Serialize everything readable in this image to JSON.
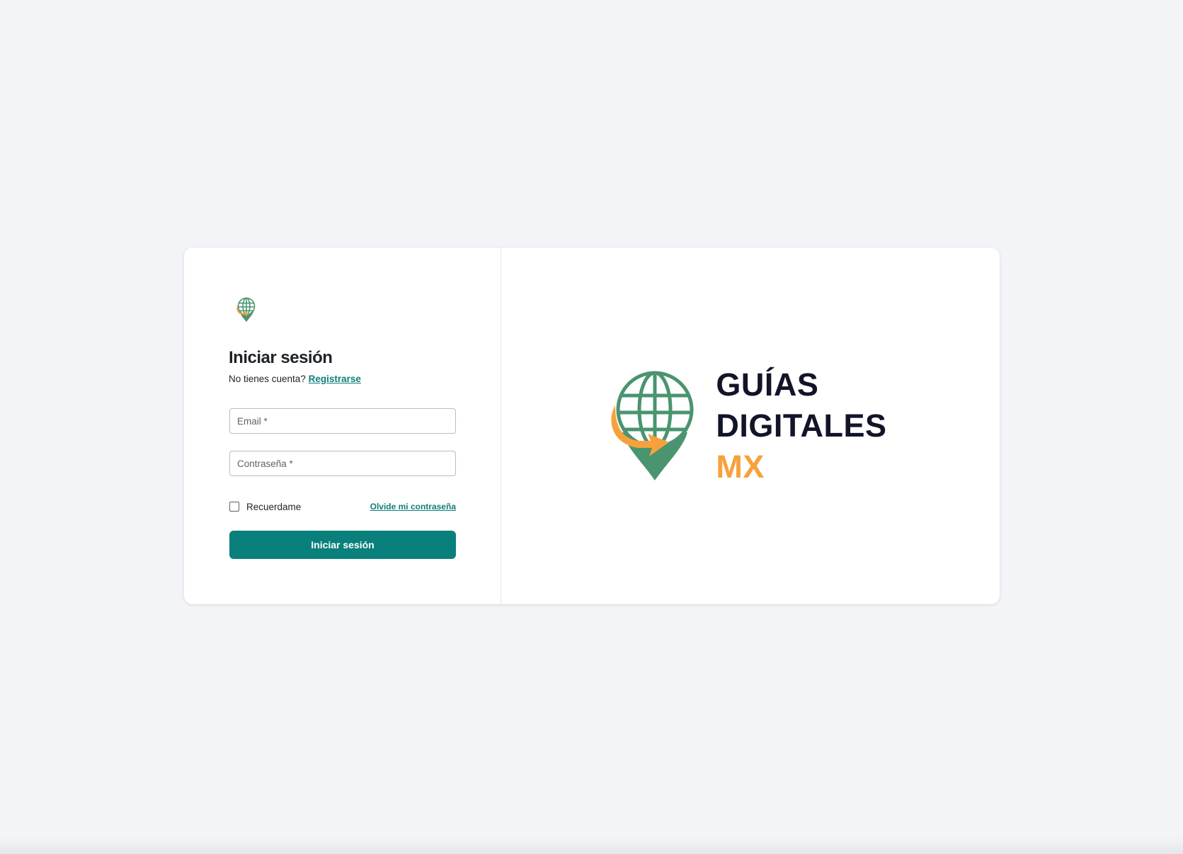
{
  "login": {
    "title": "Iniciar sesión",
    "no_account_text": "No tienes cuenta?",
    "register_link": "Registrarse",
    "email_placeholder": "Email *",
    "password_placeholder": "Contraseña *",
    "remember_label": "Recuerdame",
    "forgot_link": "Olvide mi contraseña",
    "submit_label": "Iniciar sesión"
  },
  "brand": {
    "line1": "GUÍAS",
    "line2": "DIGITALES",
    "line3": "MX",
    "colors": {
      "globe": "#4a9470",
      "arrow": "#f7a13c",
      "text_dark": "#121428",
      "accent": "#0a807c"
    },
    "icon": "globe-location-pin-icon"
  }
}
